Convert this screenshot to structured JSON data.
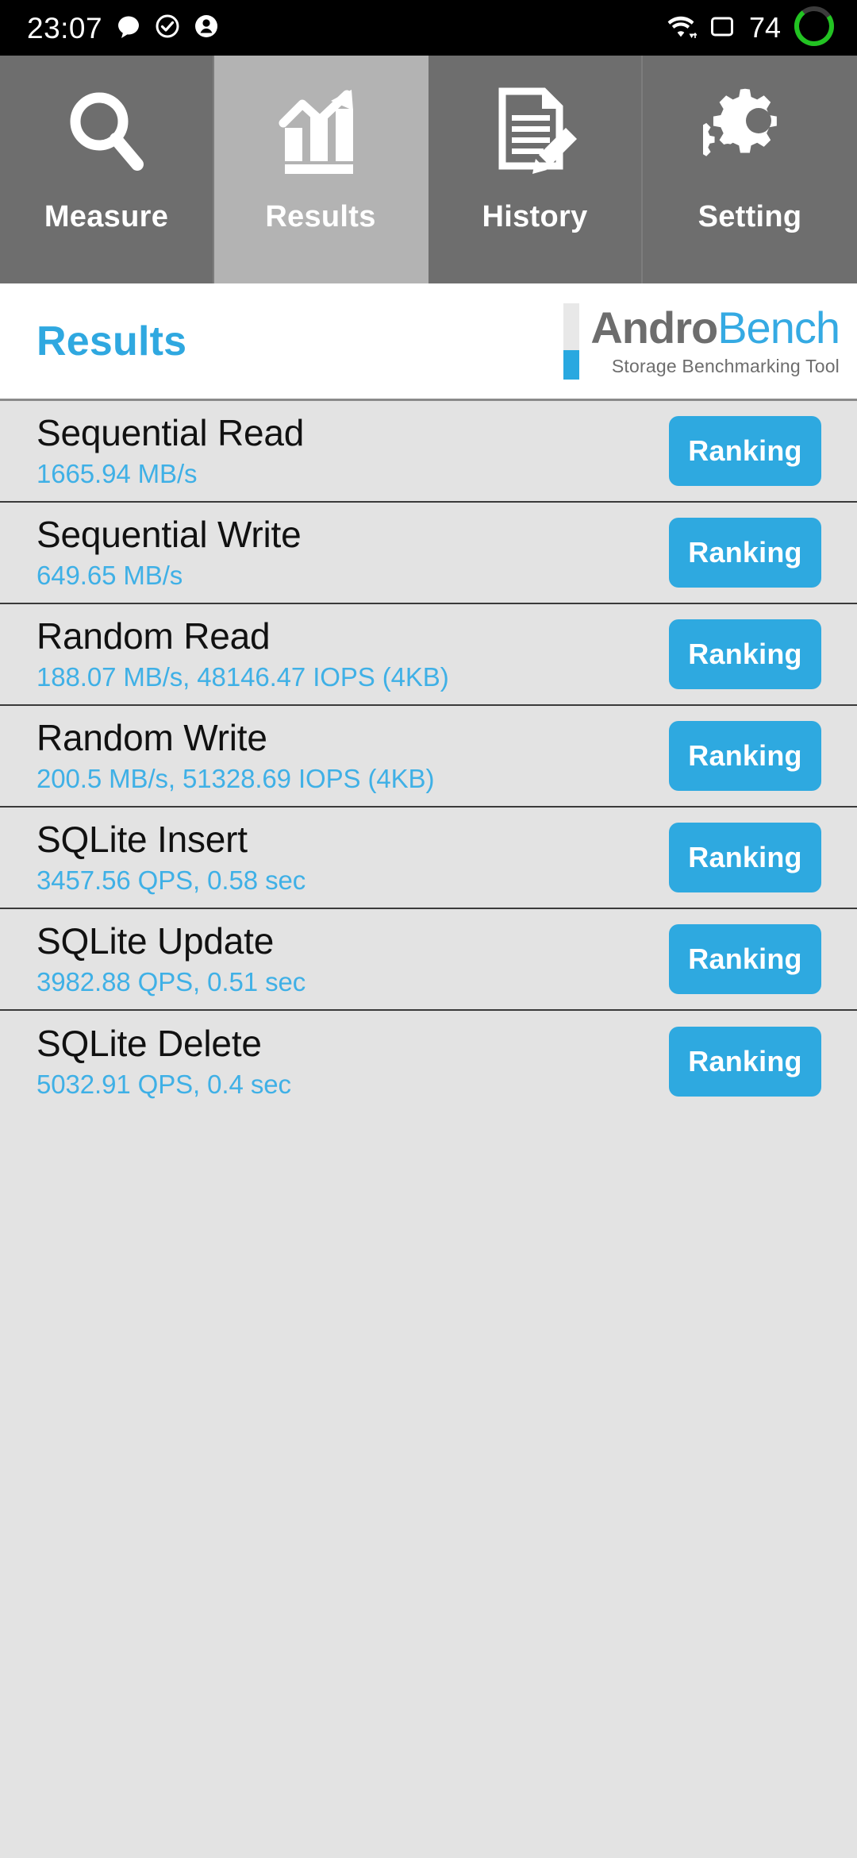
{
  "status_bar": {
    "time": "23:07",
    "battery_percent": "74",
    "left_icons": [
      "chat-bubble-icon",
      "check-circle-icon",
      "person-icon"
    ],
    "right_icons": [
      "wifi-icon",
      "sim-square-icon",
      "battery-ring-icon"
    ],
    "battery_ring_color": "#22c322",
    "background": "#000000"
  },
  "tabs": [
    {
      "label": "Measure",
      "icon": "magnifier-icon",
      "selected": false
    },
    {
      "label": "Results",
      "icon": "bar-chart-arrow-icon",
      "selected": true
    },
    {
      "label": "History",
      "icon": "document-pencil-icon",
      "selected": false
    },
    {
      "label": "Setting",
      "icon": "gears-icon",
      "selected": false
    }
  ],
  "header": {
    "title": "Results",
    "logo_primary": "Andro",
    "logo_secondary": "Bench",
    "logo_tagline": "Storage Benchmarking Tool",
    "accent_color": "#2fa8e0",
    "logo_gray": "#6d6d6d"
  },
  "results": [
    {
      "name": "Sequential Read",
      "value": "1665.94 MB/s",
      "button": "Ranking"
    },
    {
      "name": "Sequential Write",
      "value": "649.65 MB/s",
      "button": "Ranking"
    },
    {
      "name": "Random Read",
      "value": "188.07 MB/s, 48146.47 IOPS (4KB)",
      "button": "Ranking"
    },
    {
      "name": "Random Write",
      "value": "200.5 MB/s, 51328.69 IOPS (4KB)",
      "button": "Ranking"
    },
    {
      "name": "SQLite Insert",
      "value": "3457.56 QPS, 0.58 sec",
      "button": "Ranking"
    },
    {
      "name": "SQLite Update",
      "value": "3982.88 QPS, 0.51 sec",
      "button": "Ranking"
    },
    {
      "name": "SQLite Delete",
      "value": "5032.91 QPS, 0.4 sec",
      "button": "Ranking"
    }
  ],
  "colors": {
    "button_blue": "#2ea9e0",
    "value_blue": "#3fb0e6",
    "list_background": "#e3e3e3",
    "tab_background": "#6e6e6e",
    "tab_selected_background": "#b3b3b3"
  }
}
